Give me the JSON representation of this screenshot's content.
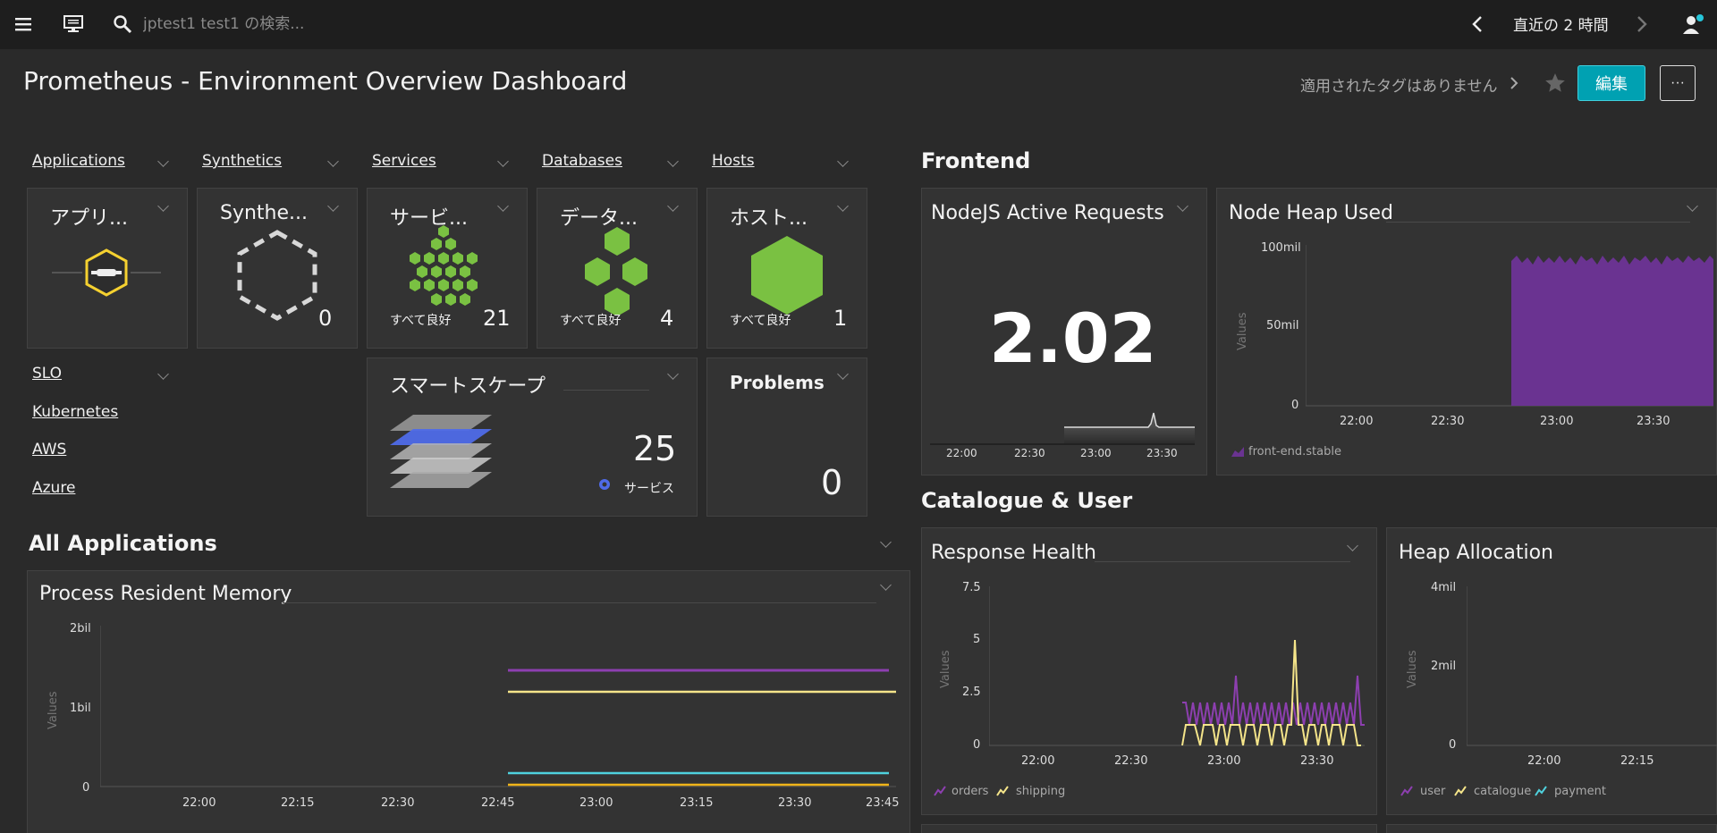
{
  "topbar": {
    "search_placeholder": "jptest1 test1 の検索...",
    "timeframe": "直近の 2 時間"
  },
  "header": {
    "title": "Prometheus - Environment Overview Dashboard",
    "tags": "適用されたタグはありません",
    "edit_label": "編集",
    "more_label": "···"
  },
  "nav_links": {
    "applications": "Applications",
    "synthetics": "Synthetics",
    "services": "Services",
    "databases": "Databases",
    "hosts": "Hosts",
    "slo": "SLO",
    "kubernetes": "Kubernetes",
    "aws": "AWS",
    "azure": "Azure"
  },
  "tiles": {
    "applications": {
      "title": "アプリ..."
    },
    "synthetics": {
      "title": "Synthe...",
      "count": "0"
    },
    "services": {
      "title": "サービ...",
      "status": "すべて良好",
      "count": "21"
    },
    "databases": {
      "title": "データ...",
      "status": "すべて良好",
      "count": "4"
    },
    "hosts": {
      "title": "ホスト...",
      "status": "すべて良好",
      "count": "1"
    },
    "smartscape": {
      "title": "スマートスケープ",
      "count": "25",
      "label": "サービス"
    },
    "problems": {
      "title": "Problems",
      "count": "0"
    }
  },
  "sections": {
    "frontend": "Frontend",
    "catalogue_user": "Catalogue & User",
    "all_applications": "All Applications"
  },
  "nodejs_active_requests": {
    "title": "NodeJS Active Requests",
    "value": "2.02",
    "x_ticks": [
      "22:00",
      "22:30",
      "23:00",
      "23:30"
    ]
  },
  "node_heap_used": {
    "title": "Node Heap Used",
    "y_ticks": [
      "100mil",
      "50mil",
      "0"
    ],
    "x_ticks": [
      "22:00",
      "22:30",
      "23:00",
      "23:30"
    ],
    "ylabel": "Values",
    "legend": "front-end.stable",
    "color": "#6a3391"
  },
  "response_health": {
    "title": "Response Health",
    "y_ticks": [
      "7.5",
      "5",
      "2.5",
      "0"
    ],
    "x_ticks": [
      "22:00",
      "22:30",
      "23:00",
      "23:30"
    ],
    "ylabel": "Values",
    "legend": [
      "orders",
      "shipping"
    ],
    "colors": [
      "#8d3fb0",
      "#f5e58a"
    ]
  },
  "heap_allocation": {
    "title": "Heap Allocation",
    "y_ticks": [
      "4mil",
      "2mil",
      "0"
    ],
    "x_ticks": [
      "22:00",
      "22:15"
    ],
    "ylabel": "Values",
    "legend": [
      "user",
      "catalogue",
      "payment"
    ],
    "colors": [
      "#8d3fb0",
      "#f5e58a",
      "#4fd1dd"
    ]
  },
  "process_resident_memory": {
    "title": "Process Resident Memory",
    "y_ticks": [
      "2bil",
      "1bil",
      "0"
    ],
    "x_ticks": [
      "22:00",
      "22:15",
      "22:30",
      "22:45",
      "23:00",
      "23:15",
      "23:30",
      "23:45"
    ],
    "ylabel": "Values",
    "colors": [
      "#8d3fb0",
      "#f5e58a",
      "#4fd1dd",
      "#f0b419"
    ]
  }
}
